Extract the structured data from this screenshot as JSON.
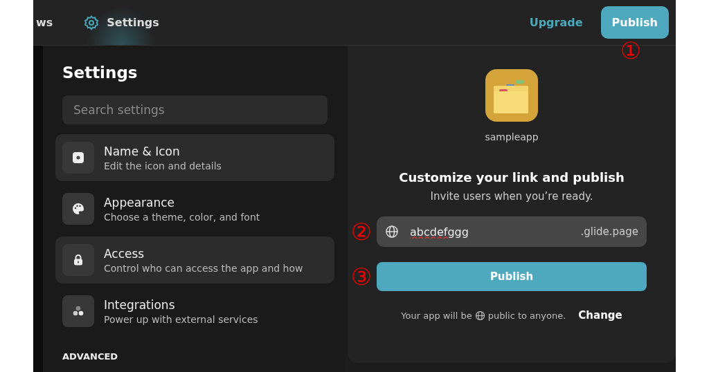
{
  "top_bar": {
    "tabs": [
      {
        "label": "ws",
        "selected": false
      },
      {
        "label": "Settings",
        "selected": true
      }
    ],
    "upgrade": "Upgrade",
    "publish": "Publish"
  },
  "settings": {
    "title": "Settings",
    "search": {
      "placeholder": "Search settings"
    },
    "items": [
      {
        "kind": "name",
        "title": "Name & Icon",
        "subtitle": "Edit the icon and details",
        "selected": true
      },
      {
        "kind": "appearance",
        "title": "Appearance",
        "subtitle": "Choose a theme, color, and font",
        "selected": false
      },
      {
        "kind": "access",
        "title": "Access",
        "subtitle": "Control who can access the app and how",
        "selected": true
      },
      {
        "kind": "integrations",
        "title": "Integrations",
        "subtitle": "Power up with external services",
        "selected": false
      }
    ],
    "section": "ADVANCED"
  },
  "publish_panel": {
    "app_name": "sampleapp",
    "heading": "Customize your link and publish",
    "subheading": "Invite users when you’re ready.",
    "link": {
      "value": "abcdefggg",
      "suffix": ".glide.page"
    },
    "button": "Publish",
    "note_before": "Your app will be",
    "note_after": "public to anyone.",
    "change": "Change"
  },
  "annotations": [
    "①",
    "②",
    "③"
  ]
}
